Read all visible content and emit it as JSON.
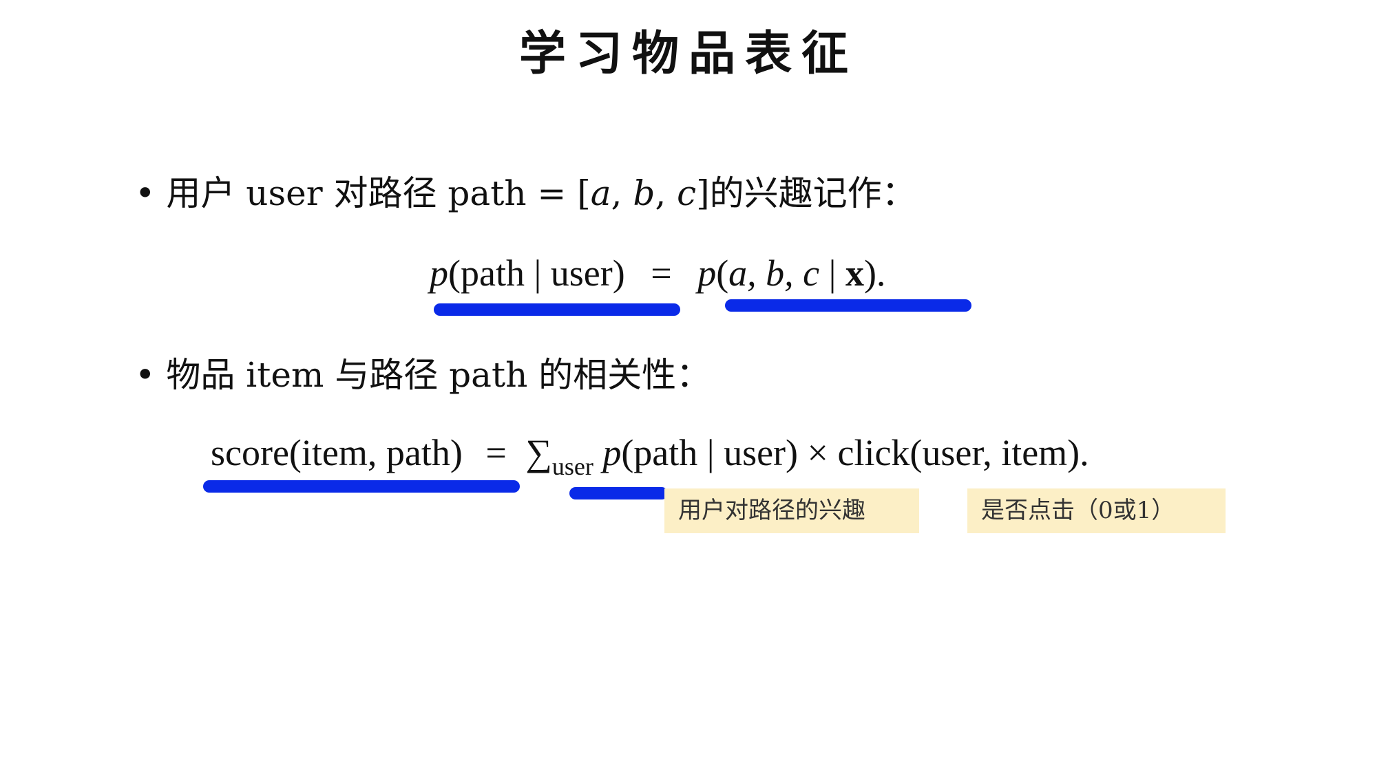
{
  "title": "学习物品表征",
  "bullets": [
    {
      "label_prefix": "用户 user 对路径 path = [",
      "vars": [
        "a",
        "b",
        "c"
      ],
      "label_suffix": "]的兴趣记作："
    },
    {
      "label": "物品 item 与路径 path 的相关性："
    }
  ],
  "formula1": {
    "lhs_fn": "p",
    "lhs_arg": "(path | user)",
    "eq": "=",
    "rhs_fn": "p",
    "rhs_open": "(",
    "rhs_vars": "a, b, c",
    "rhs_bar": " | ",
    "rhs_x": "x",
    "rhs_close": ").",
    "rhs": "p(a, b, c | x)."
  },
  "formula2": {
    "lhs": "score(item, path)",
    "eq": "=",
    "sum": "∑",
    "sum_sub": "user",
    "fn": "p",
    "rest": "(path | user) × click(user, item)."
  },
  "notes": {
    "interest": "用户对路径的兴趣",
    "click": "是否点击（0或1）"
  },
  "colors": {
    "underline": "#0a2ae8",
    "note_bg": "#fcefc6"
  }
}
